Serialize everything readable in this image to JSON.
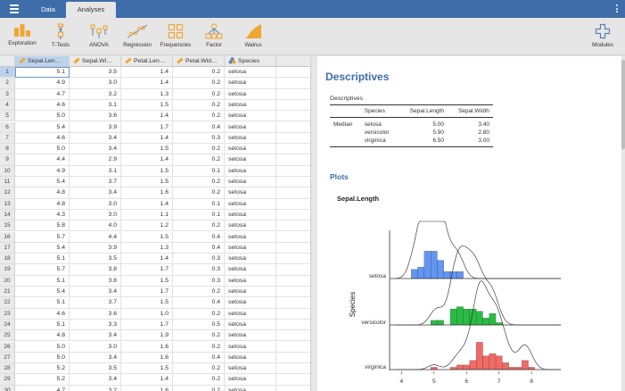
{
  "titlebar": {
    "tabs": [
      "Data",
      "Analyses"
    ]
  },
  "ribbon": {
    "buttons": [
      {
        "label": "Exploration",
        "icon": "exploration-icon"
      },
      {
        "label": "T-Tests",
        "icon": "ttests-icon"
      },
      {
        "label": "ANOVA",
        "icon": "anova-icon"
      },
      {
        "label": "Regression",
        "icon": "regression-icon"
      },
      {
        "label": "Frequencies",
        "icon": "frequencies-icon"
      },
      {
        "label": "Factor",
        "icon": "factor-icon"
      },
      {
        "label": "Walrus",
        "icon": "walrus-icon"
      },
      {
        "label": "Modules",
        "icon": "plus-icon"
      }
    ],
    "accent_color": "#f0a632"
  },
  "sheet": {
    "columns": [
      "Sepal.Len…",
      "Sepal.Wi…",
      "Petal.Len…",
      "Petal.Wid…",
      "Species"
    ],
    "row_numbers": [
      1,
      2,
      3,
      4,
      5,
      6,
      7,
      8,
      9,
      10,
      11,
      12,
      13,
      14,
      15,
      16,
      17,
      18,
      19,
      20,
      21,
      22,
      23,
      24,
      25,
      26,
      27,
      28,
      29,
      30
    ],
    "rows": [
      [
        "5.1",
        "3.5",
        "1.4",
        "0.2",
        "setosa"
      ],
      [
        "4.9",
        "3.0",
        "1.4",
        "0.2",
        "setosa"
      ],
      [
        "4.7",
        "3.2",
        "1.3",
        "0.2",
        "setosa"
      ],
      [
        "4.6",
        "3.1",
        "1.5",
        "0.2",
        "setosa"
      ],
      [
        "5.0",
        "3.6",
        "1.4",
        "0.2",
        "setosa"
      ],
      [
        "5.4",
        "3.9",
        "1.7",
        "0.4",
        "setosa"
      ],
      [
        "4.6",
        "3.4",
        "1.4",
        "0.3",
        "setosa"
      ],
      [
        "5.0",
        "3.4",
        "1.5",
        "0.2",
        "setosa"
      ],
      [
        "4.4",
        "2.9",
        "1.4",
        "0.2",
        "setosa"
      ],
      [
        "4.9",
        "3.1",
        "1.5",
        "0.1",
        "setosa"
      ],
      [
        "5.4",
        "3.7",
        "1.5",
        "0.2",
        "setosa"
      ],
      [
        "4.8",
        "3.4",
        "1.6",
        "0.2",
        "setosa"
      ],
      [
        "4.8",
        "3.0",
        "1.4",
        "0.1",
        "setosa"
      ],
      [
        "4.3",
        "3.0",
        "1.1",
        "0.1",
        "setosa"
      ],
      [
        "5.8",
        "4.0",
        "1.2",
        "0.2",
        "setosa"
      ],
      [
        "5.7",
        "4.4",
        "1.5",
        "0.4",
        "setosa"
      ],
      [
        "5.4",
        "3.9",
        "1.3",
        "0.4",
        "setosa"
      ],
      [
        "5.1",
        "3.5",
        "1.4",
        "0.3",
        "setosa"
      ],
      [
        "5.7",
        "3.8",
        "1.7",
        "0.3",
        "setosa"
      ],
      [
        "5.1",
        "3.8",
        "1.5",
        "0.3",
        "setosa"
      ],
      [
        "5.4",
        "3.4",
        "1.7",
        "0.2",
        "setosa"
      ],
      [
        "5.1",
        "3.7",
        "1.5",
        "0.4",
        "setosa"
      ],
      [
        "4.6",
        "3.6",
        "1.0",
        "0.2",
        "setosa"
      ],
      [
        "5.1",
        "3.3",
        "1.7",
        "0.5",
        "setosa"
      ],
      [
        "4.8",
        "3.4",
        "1.9",
        "0.2",
        "setosa"
      ],
      [
        "5.0",
        "3.0",
        "1.6",
        "0.2",
        "setosa"
      ],
      [
        "5.0",
        "3.4",
        "1.6",
        "0.4",
        "setosa"
      ],
      [
        "5.2",
        "3.5",
        "1.5",
        "0.2",
        "setosa"
      ],
      [
        "5.2",
        "3.4",
        "1.4",
        "0.2",
        "setosa"
      ],
      [
        "4.7",
        "3.2",
        "1.6",
        "0.2",
        "setosa"
      ]
    ]
  },
  "results": {
    "title": "Descriptives",
    "table_caption": "Descriptives",
    "table_headers": [
      "",
      "Species",
      "Sepal.Length",
      "Sepal.Width"
    ],
    "table_rows": [
      [
        "Median",
        "setosa",
        "5.00",
        "3.40"
      ],
      [
        "",
        "versicolor",
        "5.90",
        "2.80"
      ],
      [
        "",
        "virginica",
        "6.50",
        "3.00"
      ]
    ],
    "plots_title": "Plots",
    "plot_name": "Sepal.Length"
  },
  "chart_data": {
    "type": "histogram",
    "title": "Sepal.Length",
    "ylabel": "Species",
    "xlabel": "",
    "xlim": [
      3.8,
      8.9
    ],
    "x_ticks": [
      4,
      5,
      6,
      7,
      8
    ],
    "bin_width": 0.2,
    "series": [
      {
        "name": "setosa",
        "color": "#5b8ff2",
        "bin_starts": [
          4.3,
          4.5,
          4.7,
          4.9,
          5.1,
          5.3,
          5.5,
          5.7
        ],
        "counts": [
          4,
          5,
          12,
          12,
          8,
          3,
          3,
          3
        ]
      },
      {
        "name": "versicolor",
        "color": "#1db838",
        "bin_starts": [
          4.9,
          5.1,
          5.5,
          5.7,
          5.9,
          6.1,
          6.3,
          6.5,
          6.7,
          6.9
        ],
        "counts": [
          2,
          2,
          7,
          8,
          7,
          7,
          6,
          3,
          5,
          1
        ]
      },
      {
        "name": "virginica",
        "color": "#f0625d",
        "bin_starts": [
          4.9,
          5.5,
          5.7,
          5.9,
          6.1,
          6.3,
          6.5,
          6.7,
          6.9,
          7.1,
          7.3,
          7.5,
          7.7,
          7.9
        ],
        "counts": [
          1,
          1,
          2,
          2,
          4,
          12,
          6,
          7,
          6,
          3,
          1,
          1,
          4,
          1
        ]
      }
    ]
  }
}
